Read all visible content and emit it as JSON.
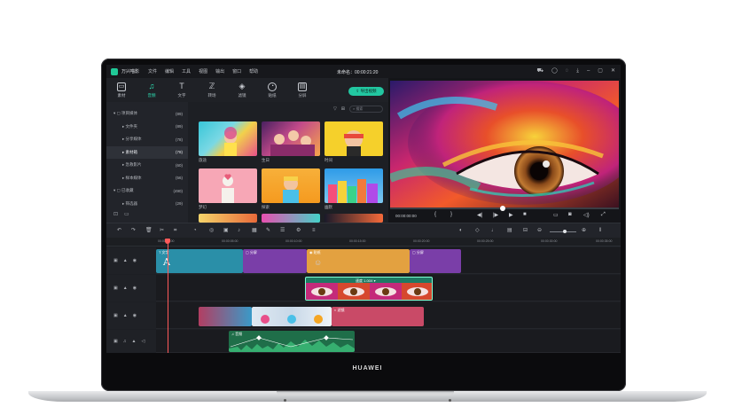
{
  "app": {
    "name": "万兴喵影",
    "menu": [
      "文件",
      "编辑",
      "工具",
      "视图",
      "输出",
      "窗口",
      "帮助"
    ],
    "project_title": "未命名：00:00:21:20",
    "window_controls": [
      "cart-icon",
      "user-icon",
      "lightbulb-icon",
      "download-icon",
      "minimize-icon",
      "maximize-icon",
      "close-icon"
    ]
  },
  "toolbar_tabs": [
    {
      "label": "素材",
      "icon": "folder-icon",
      "glyph": "▭"
    },
    {
      "label": "音频",
      "icon": "music-icon",
      "glyph": "♫",
      "active": true
    },
    {
      "label": "文字",
      "icon": "text-icon",
      "glyph": "T"
    },
    {
      "label": "转场",
      "icon": "transition-icon",
      "glyph": "ℤ"
    },
    {
      "label": "滤镜",
      "icon": "filter-icon",
      "glyph": "◈"
    },
    {
      "label": "贴纸",
      "icon": "sticker-icon",
      "glyph": "◔"
    },
    {
      "label": "分屏",
      "icon": "split-screen-icon",
      "glyph": "▤"
    }
  ],
  "export_button": "⇪ 导出视频",
  "sidebar": {
    "items": [
      {
        "label": "▾ ▢ 项目媒体",
        "count": "(89)"
      },
      {
        "label": "▸ 文件夹",
        "count": "(89)",
        "sub": true
      },
      {
        "label": "▸ 分享媒体",
        "count": "(78)",
        "sub": true
      },
      {
        "label": "▸ 素材箱",
        "count": "(78)",
        "sub": true,
        "selected": true
      },
      {
        "label": "▸ 急救影片",
        "count": "(60)",
        "sub": true
      },
      {
        "label": "▸ 样本媒体",
        "count": "(56)",
        "sub": true
      },
      {
        "label": "▾ ▢ 已收藏",
        "count": "(490)"
      },
      {
        "label": "▸ 筛选器",
        "count": "(29)",
        "sub": true
      }
    ],
    "footer_icons": [
      "new-folder-icon",
      "folder-icon"
    ]
  },
  "media": {
    "search_placeholder": "搜索",
    "thumbnails": [
      {
        "label": "旅途",
        "colors": [
          "#38c6d8",
          "#f2d14b",
          "#e84f8a"
        ]
      },
      {
        "label": "生日",
        "colors": [
          "#5a2a6e",
          "#d94b8c",
          "#f7a64a"
        ]
      },
      {
        "label": "时间",
        "colors": [
          "#f5d02b",
          "#e8493b",
          "#2a2a2a"
        ]
      },
      {
        "label": "梦幻",
        "colors": [
          "#f7a7b6",
          "#f5f1ec",
          "#e85c7a"
        ]
      },
      {
        "label": "探索",
        "colors": [
          "#f5a623",
          "#4ac0e8",
          "#f7d24a"
        ]
      },
      {
        "label": "幽默",
        "colors": [
          "#2e9be8",
          "#f54f7a",
          "#f6d23a"
        ]
      }
    ]
  },
  "preview": {
    "timecode": "00:00:00:00",
    "progress": 0.5
  },
  "ruler": {
    "ticks": [
      "00:00:00:00",
      "00:00:05:00",
      "00:00:10:00",
      "00:00:15:00",
      "00:00:20:00",
      "00:00:25:00",
      "00:00:30:00",
      "00:00:35:00"
    ]
  },
  "tracks": [
    {
      "name": "text-track",
      "clips": [
        {
          "label": "T 文字",
          "color": "#2a8fa8"
        },
        {
          "label": "▢ 分屏",
          "color": "#7a3ea8"
        },
        {
          "label": "◉ 贴纸",
          "color": "#e3a140"
        },
        {
          "label": "▢ 分屏",
          "color": "#7a3ea8"
        }
      ]
    },
    {
      "name": "overlay-track",
      "clips": [
        {
          "label": "速度 1.00X ▾",
          "color": "#1e7a63"
        }
      ]
    },
    {
      "name": "video-track",
      "clips": [
        {
          "label": "",
          "color": "#b23e62"
        },
        {
          "label": "",
          "color": "#dfe9f2"
        },
        {
          "label": "◐ 滤镜",
          "color": "#c94a67"
        }
      ]
    },
    {
      "name": "audio-track",
      "clips": [
        {
          "label": "♫ 音频",
          "color": "#1f6e49"
        }
      ]
    }
  ],
  "laptop_brand": "HUAWEI"
}
